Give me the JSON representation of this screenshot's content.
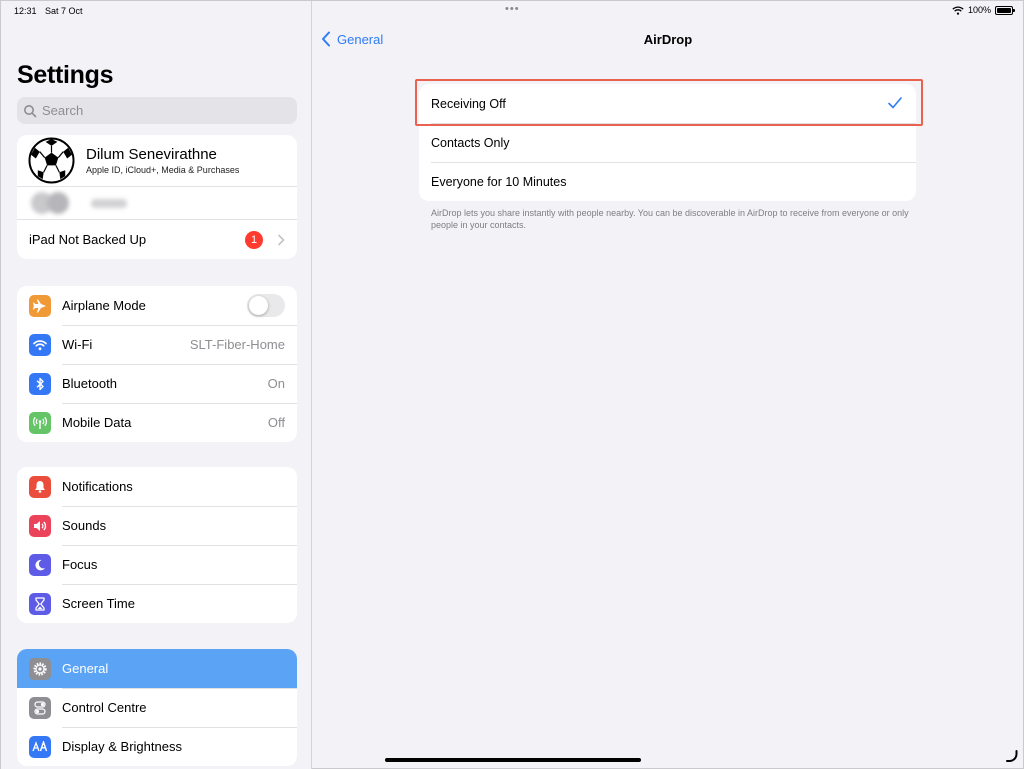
{
  "status_bar": {
    "time": "12:31",
    "date": "Sat 7 Oct",
    "battery_percent": "100%"
  },
  "sidebar": {
    "title": "Settings",
    "search_placeholder": "Search",
    "profile": {
      "name": "Dilum Senevirathne",
      "subtitle": "Apple ID, iCloud+, Media & Purchases"
    },
    "backup": {
      "label": "iPad Not Backed Up",
      "badge": "1"
    },
    "group1": [
      {
        "label": "Airplane Mode",
        "icon": "airplane-icon",
        "color": "#f09a37",
        "toggle": false
      },
      {
        "label": "Wi-Fi",
        "icon": "wifi-icon",
        "color": "#3478f6",
        "value": "SLT-Fiber-Home"
      },
      {
        "label": "Bluetooth",
        "icon": "bluetooth-icon",
        "color": "#3478f6",
        "value": "On"
      },
      {
        "label": "Mobile Data",
        "icon": "antenna-icon",
        "color": "#65c466",
        "value": "Off"
      }
    ],
    "group2": [
      {
        "label": "Notifications",
        "icon": "bell-icon",
        "color": "#eb4d3d"
      },
      {
        "label": "Sounds",
        "icon": "speaker-icon",
        "color": "#eb445a"
      },
      {
        "label": "Focus",
        "icon": "moon-icon",
        "color": "#5e5ce6"
      },
      {
        "label": "Screen Time",
        "icon": "hourglass-icon",
        "color": "#5e5ce6"
      }
    ],
    "group3": [
      {
        "label": "General",
        "icon": "gear-icon",
        "color": "#8e8e93",
        "selected": true
      },
      {
        "label": "Control Centre",
        "icon": "switches-icon",
        "color": "#8e8e93"
      },
      {
        "label": "Display & Brightness",
        "icon": "text-size-icon",
        "color": "#3478f6"
      }
    ]
  },
  "detail": {
    "back_label": "General",
    "title": "AirDrop",
    "options": [
      {
        "label": "Receiving Off",
        "checked": true
      },
      {
        "label": "Contacts Only",
        "checked": false
      },
      {
        "label": "Everyone for 10 Minutes",
        "checked": false
      }
    ],
    "footnote": "AirDrop lets you share instantly with people nearby. You can be discoverable in AirDrop to receive from everyone or only people in your contacts."
  },
  "colors": {
    "accent": "#2f7cf6",
    "selection": "#5aa3f5",
    "highlight_box": "#e8624f",
    "badge": "#ff3b30"
  }
}
